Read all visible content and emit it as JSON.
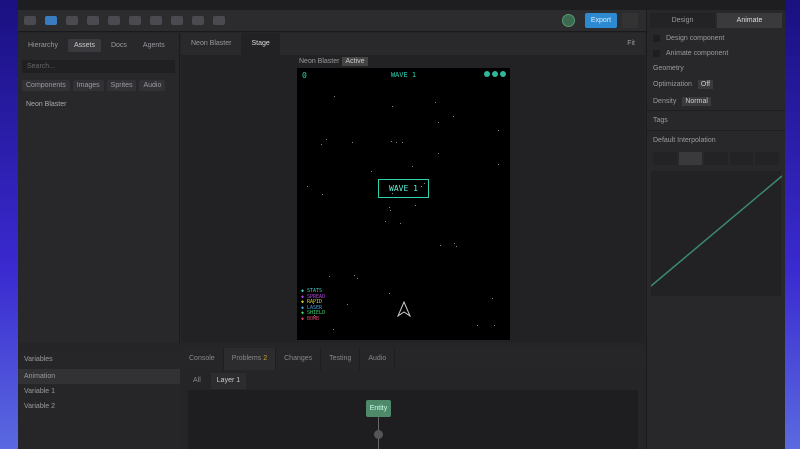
{
  "window": {
    "title": "Neon Blaster"
  },
  "toolbar": {
    "share_label": "Export"
  },
  "left_panel": {
    "tabs": [
      "Hierarchy",
      "Assets",
      "Docs",
      "Agents"
    ],
    "active_tab": 1,
    "search_placeholder": "Search...",
    "chips": [
      "Components",
      "Images",
      "Sprites",
      "Audio"
    ],
    "tree_item": "Neon Blaster",
    "bottom_header": "Variables",
    "bottom_items": [
      "Animation",
      "Variable 1",
      "Variable 2"
    ]
  },
  "editor": {
    "tabs": [
      "Neon Blaster",
      "Stage"
    ],
    "stage_name": "Neon Blaster",
    "stage_badge": "Active",
    "zoom": "Fit"
  },
  "game": {
    "score": "0",
    "wave_label": "WAVE 1",
    "wave_banner": "WAVE 1",
    "lives": 3,
    "legend": [
      {
        "text": "STATS",
        "color": "#40d0c0"
      },
      {
        "text": "SPREAD",
        "color": "#b040e0"
      },
      {
        "text": "RAPID",
        "color": "#d0d030"
      },
      {
        "text": "LASER",
        "color": "#40a0e0"
      },
      {
        "text": "SHIELD",
        "color": "#40d070"
      },
      {
        "text": "BOMB",
        "color": "#e04070"
      }
    ]
  },
  "bottom_panel": {
    "tabs": [
      "Console",
      "Problems",
      "Changes",
      "Testing",
      "Audio"
    ],
    "problems_count": "2",
    "subtabs": [
      "All",
      "Layer 1"
    ],
    "node_label": "Entity"
  },
  "right_panel": {
    "modes": [
      "Design",
      "Animate"
    ],
    "checkboxes": [
      "Design component",
      "Animate component"
    ],
    "geometry_label": "Geometry",
    "optimization_label": "Optimization",
    "optimization_value": "Off",
    "density_label": "Density",
    "density_value": "Normal",
    "tags_label": "Tags",
    "interp_label": "Default Interpolation"
  }
}
